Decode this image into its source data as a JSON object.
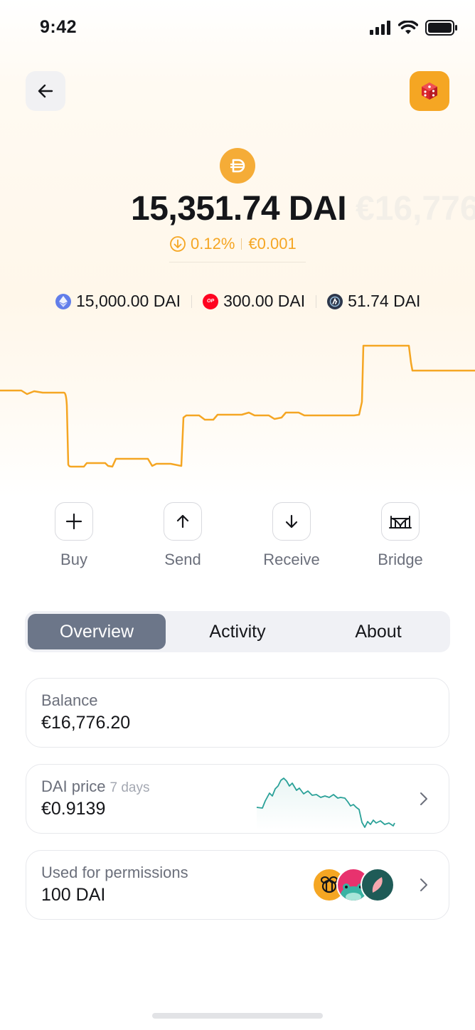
{
  "status": {
    "time": "9:42"
  },
  "nav": {
    "back_icon": "arrow-left-icon",
    "dice_icon": "dice-icon"
  },
  "token": {
    "symbol": "DAI",
    "balance": "15,351.74 DAI",
    "fiat_ghost": "€16,776",
    "change_percent": "0.12%",
    "change_fiat": "€0.001",
    "change_direction": "down"
  },
  "chains": [
    {
      "network": "ethereum",
      "amount": "15,000.00 DAI",
      "color": "#627eea"
    },
    {
      "network": "optimism",
      "label": "OP",
      "amount": "300.00 DAI",
      "color": "#ff0420"
    },
    {
      "network": "arbitrum",
      "amount": "51.74 DAI",
      "color": "#2d374b"
    }
  ],
  "actions": [
    {
      "label": "Buy",
      "icon": "plus-icon"
    },
    {
      "label": "Send",
      "icon": "arrow-up-icon"
    },
    {
      "label": "Receive",
      "icon": "arrow-down-icon"
    },
    {
      "label": "Bridge",
      "icon": "bridge-icon"
    }
  ],
  "tabs": [
    {
      "label": "Overview",
      "active": true
    },
    {
      "label": "Activity",
      "active": false
    },
    {
      "label": "About",
      "active": false
    }
  ],
  "cards": {
    "balance": {
      "label": "Balance",
      "value": "€16,776.20"
    },
    "price": {
      "label": "DAI price",
      "period": "7 days",
      "value": "€0.9139"
    },
    "permissions": {
      "label": "Used for permissions",
      "value": "100 DAI"
    }
  },
  "colors": {
    "accent": "#f5a623",
    "sparkline": "#2aa198",
    "tab_active": "#6c7689"
  }
}
